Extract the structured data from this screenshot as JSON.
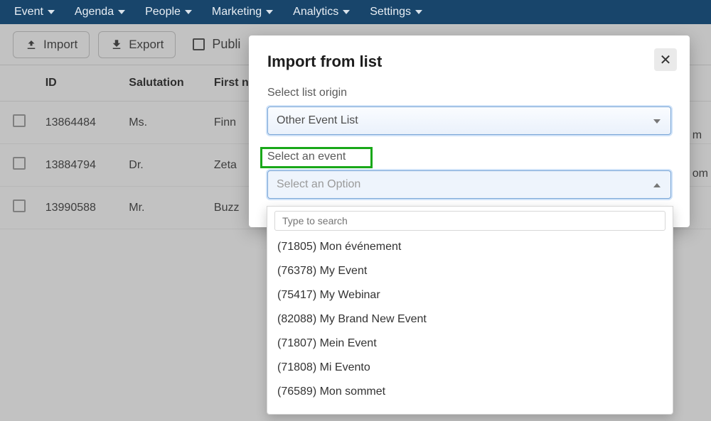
{
  "nav": {
    "items": [
      "Event",
      "Agenda",
      "People",
      "Marketing",
      "Analytics",
      "Settings"
    ]
  },
  "toolbar": {
    "import": "Import",
    "export": "Export",
    "publish": "Publi"
  },
  "columns": {
    "chk": "",
    "id": "ID",
    "sal": "Salutation",
    "fn": "First nam"
  },
  "rows": [
    {
      "id": "13864484",
      "sal": "Ms.",
      "fn": "Finn",
      "trail": "m"
    },
    {
      "id": "13884794",
      "sal": "Dr.",
      "fn": "Zeta",
      "trail": "om"
    },
    {
      "id": "13990588",
      "sal": "Mr.",
      "fn": "Buzz",
      "trail": ""
    }
  ],
  "modal": {
    "title": "Import from list",
    "label_origin": "Select list origin",
    "origin_value": "Other Event List",
    "label_event": "Select an event",
    "event_placeholder": "Select an Option",
    "search_placeholder": "Type to search",
    "options": [
      "(71805) Mon événement",
      "(76378) My Event",
      "(75417) My Webinar",
      "(82088) My Brand New Event",
      "(71807) Mein Event",
      "(71808) Mi Evento",
      "(76589) Mon sommet"
    ]
  }
}
